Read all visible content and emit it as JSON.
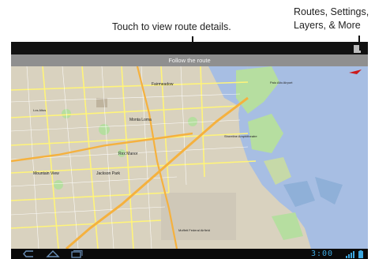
{
  "callouts": {
    "route": "Touch to view route details.",
    "menu_line1": "Routes, Settings,",
    "menu_line2": "Layers, & More"
  },
  "banner": {
    "label": "Follow the route"
  },
  "map": {
    "labels": {
      "fairmeadow": "Fairmeadow",
      "palo_alto_airport": "Palo Alto Airport",
      "los_altos": "Los Altos",
      "monta_loma": "Monta Loma",
      "shoreline": "Shoreline Amphitheatre",
      "rex_manor": "Rex Manor",
      "mountain_view": "Mountain View",
      "jackson_park": "Jackson Park",
      "moffett": "Moffett Federal Airfield"
    }
  },
  "status": {
    "time": "3:00"
  },
  "icons": {
    "menu": "overflow-menu-icon",
    "back": "back-icon",
    "home": "home-icon",
    "recent": "recent-apps-icon",
    "signal": "signal-icon",
    "battery": "battery-icon",
    "compass": "compass-icon"
  },
  "colors": {
    "water": "#a7bee3",
    "land": "#d9d2bf",
    "park": "#b6dea0",
    "road": "#fff47a",
    "highway": "#f5b13e",
    "clock": "#3ea8e0"
  }
}
